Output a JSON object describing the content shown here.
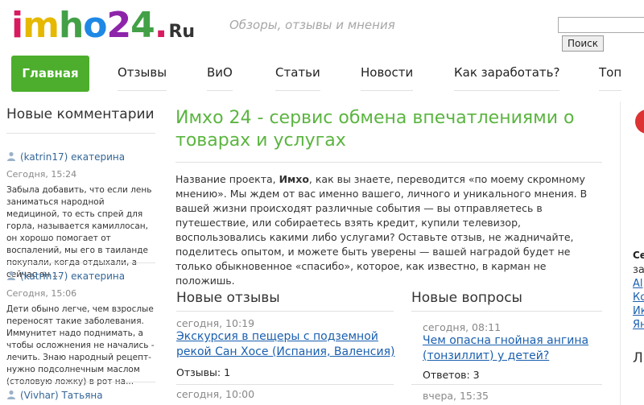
{
  "header": {
    "logo_parts": [
      "i",
      "m",
      "h",
      "o",
      "2",
      "4",
      ".",
      "Ru"
    ],
    "slogan": "Обзоры, отзывы и мнения",
    "search": {
      "placeholder": "",
      "button_label": "Поиск"
    }
  },
  "nav": {
    "items": [
      {
        "label": "Главная"
      },
      {
        "label": "Отзывы"
      },
      {
        "label": "ВиО"
      },
      {
        "label": "Статьи"
      },
      {
        "label": "Новости"
      },
      {
        "label": "Как заработать?"
      },
      {
        "label": "Топ"
      }
    ]
  },
  "sidebar": {
    "title": "Новые комментарии",
    "comments": [
      {
        "author": "(katrin17) екатерина",
        "time": "Сегодня, 15:24",
        "text": "Забыла добавить, что если лень заниматься народной медициной, то есть спрей для горла, называется камиллосан, он хорошо помогает от воспалений, мы его в таиланде покупали, когда отдыхали, а сейчас он ..."
      },
      {
        "author": "(katrin17) екатерина",
        "time": "Сегодня, 15:06",
        "text": "Дети обыно легче, чем взрослые переносят такие заболевания. Иммунитет надо поднимать, а чтобы осложнения не начались - лечить. Знаю народный рецепт- нужно подсолнечным маслом (столовую ложку) в рот на..."
      },
      {
        "author": "(Vivhar) Татьяна"
      }
    ]
  },
  "main": {
    "title": "Имхо 24 - сервис обмена впечатлениями о товарах и услугах",
    "intro_before": "Название проекта, ",
    "intro_bold": "Имхо",
    "intro_after": ", как вы знаете, переводится «по моему скромному мнению». Мы ждем от вас именно вашего, личного и уникального мнения. В вашей жизни происходят различные события — вы отправляетесь в путешествие, или собираетесь взять кредит, купили телевизор, воспользовались какими либо услугами? Оставьте отзыв, не жадничайте, поделитесь опытом, и можете быть уверены — вашей наградой будет не только обыкновенное «спасибо», которое, как известно, в карман не положишь.",
    "reviews": {
      "title": "Новые отзывы",
      "items": [
        {
          "date": "сегодня, 10:19",
          "link": "Экскурсия в пещеры с подземной рекой Сан Хосе (Испания, Валенсия)",
          "count_label": "Отзывы:",
          "count": "1"
        },
        {
          "date": "сегодня, 10:00"
        }
      ]
    },
    "questions": {
      "title": "Новые вопросы",
      "items": [
        {
          "date": "сегодня, 08:11",
          "link": "Чем опасна гнойная ангина (тонзиллит) у детей?",
          "count_label": "Ответов:",
          "count": "3"
        },
        {
          "date": "вчера, 15:35"
        }
      ]
    }
  },
  "right_edge": {
    "heading": "Се",
    "sub": "за",
    "links": [
      "Al",
      "Ко",
      "Ик",
      "Ян"
    ],
    "bottom": "Л"
  },
  "colors": {
    "brand_green": "#4cae2c",
    "title_green": "#5bb540",
    "link_blue": "#1a5faf"
  }
}
